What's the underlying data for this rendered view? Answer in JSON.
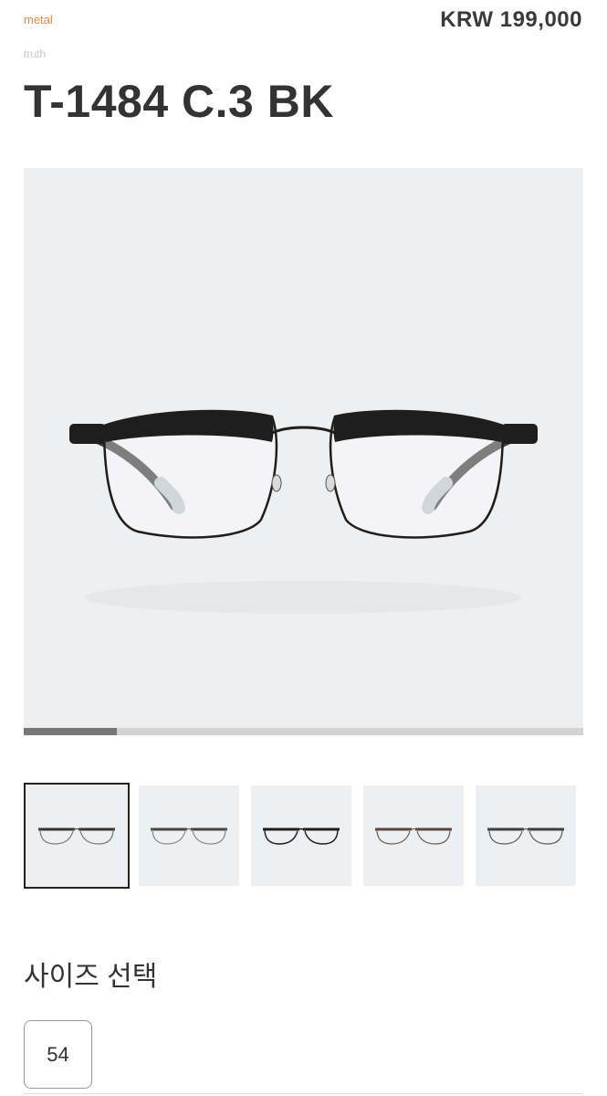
{
  "product": {
    "category": "metal",
    "brand": "truth",
    "title": "T-1484 C.3 BK",
    "price": "KRW 199,000"
  },
  "gallery": {
    "main_image_icon": "eyeglasses-black-browline",
    "slide_progress": 0.167,
    "slide_index": 1,
    "slide_count": 6,
    "thumbnails": [
      {
        "icon": "eyeglasses-silver-browline",
        "selected": true
      },
      {
        "icon": "eyeglasses-silver-browline",
        "selected": false
      },
      {
        "icon": "eyeglasses-black-browline",
        "selected": false
      },
      {
        "icon": "eyeglasses-brown-browline",
        "selected": false
      },
      {
        "icon": "eyeglasses-gray-browline",
        "selected": false
      }
    ]
  },
  "size_select": {
    "heading": "사이즈 선택",
    "options": [
      "54"
    ]
  },
  "colors": {
    "accent": "#d98a4a",
    "image_bg": "#eeeff1",
    "frame_black": "#1e1e1e"
  }
}
